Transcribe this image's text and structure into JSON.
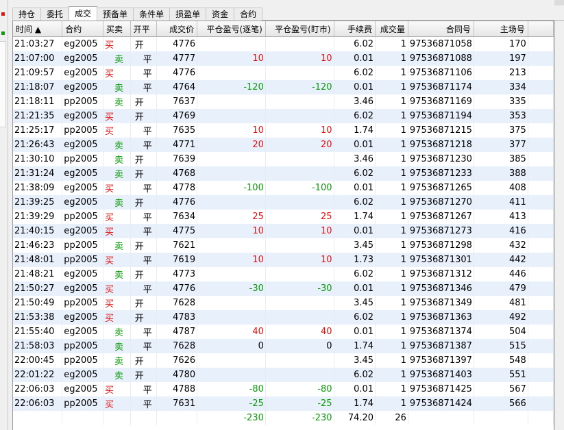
{
  "tabs": [
    "持仓",
    "委托",
    "成交",
    "预备单",
    "条件单",
    "损盈单",
    "资金",
    "合约"
  ],
  "active_tab": "成交",
  "columns": [
    "时间 ▲",
    "合约",
    "买卖",
    "开平",
    "成交价",
    "平仓盈亏(逐笔)",
    "平仓盈亏(盯市)",
    "手续费",
    "成交量",
    "合同号",
    "主场号"
  ],
  "rows": [
    {
      "time": "21:03:27",
      "contract": "eg2005",
      "side": "买",
      "oc": "开",
      "price": "4776",
      "pnl_trade": "",
      "pnl_mark": "",
      "fee": "6.02",
      "qty": "1",
      "order_no": "97536871058",
      "match_no": "170"
    },
    {
      "time": "21:07:00",
      "contract": "eg2005",
      "side": "卖",
      "oc": "平",
      "price": "4777",
      "pnl_trade": "10",
      "pnl_mark": "10",
      "fee": "0.01",
      "qty": "1",
      "order_no": "97536871088",
      "match_no": "197"
    },
    {
      "time": "21:09:57",
      "contract": "eg2005",
      "side": "买",
      "oc": "平",
      "price": "4776",
      "pnl_trade": "",
      "pnl_mark": "",
      "fee": "6.02",
      "qty": "1",
      "order_no": "97536871106",
      "match_no": "213"
    },
    {
      "time": "21:18:07",
      "contract": "eg2005",
      "side": "卖",
      "oc": "平",
      "price": "4764",
      "pnl_trade": "-120",
      "pnl_mark": "-120",
      "fee": "0.01",
      "qty": "1",
      "order_no": "97536871174",
      "match_no": "334"
    },
    {
      "time": "21:18:11",
      "contract": "pp2005",
      "side": "卖",
      "oc": "开",
      "price": "7637",
      "pnl_trade": "",
      "pnl_mark": "",
      "fee": "3.46",
      "qty": "1",
      "order_no": "97536871169",
      "match_no": "335"
    },
    {
      "time": "21:21:35",
      "contract": "eg2005",
      "side": "买",
      "oc": "开",
      "price": "4769",
      "pnl_trade": "",
      "pnl_mark": "",
      "fee": "6.02",
      "qty": "1",
      "order_no": "97536871194",
      "match_no": "353"
    },
    {
      "time": "21:25:17",
      "contract": "pp2005",
      "side": "买",
      "oc": "平",
      "price": "7635",
      "pnl_trade": "10",
      "pnl_mark": "10",
      "fee": "1.74",
      "qty": "1",
      "order_no": "97536871215",
      "match_no": "375"
    },
    {
      "time": "21:26:43",
      "contract": "eg2005",
      "side": "卖",
      "oc": "平",
      "price": "4771",
      "pnl_trade": "20",
      "pnl_mark": "20",
      "fee": "0.01",
      "qty": "1",
      "order_no": "97536871218",
      "match_no": "377"
    },
    {
      "time": "21:30:10",
      "contract": "pp2005",
      "side": "卖",
      "oc": "开",
      "price": "7639",
      "pnl_trade": "",
      "pnl_mark": "",
      "fee": "3.46",
      "qty": "1",
      "order_no": "97536871230",
      "match_no": "385"
    },
    {
      "time": "21:31:24",
      "contract": "eg2005",
      "side": "卖",
      "oc": "开",
      "price": "4768",
      "pnl_trade": "",
      "pnl_mark": "",
      "fee": "6.02",
      "qty": "1",
      "order_no": "97536871233",
      "match_no": "388"
    },
    {
      "time": "21:38:09",
      "contract": "eg2005",
      "side": "买",
      "oc": "平",
      "price": "4778",
      "pnl_trade": "-100",
      "pnl_mark": "-100",
      "fee": "0.01",
      "qty": "1",
      "order_no": "97536871265",
      "match_no": "408"
    },
    {
      "time": "21:39:25",
      "contract": "eg2005",
      "side": "卖",
      "oc": "开",
      "price": "4776",
      "pnl_trade": "",
      "pnl_mark": "",
      "fee": "6.02",
      "qty": "1",
      "order_no": "97536871270",
      "match_no": "411"
    },
    {
      "time": "21:39:29",
      "contract": "pp2005",
      "side": "买",
      "oc": "平",
      "price": "7634",
      "pnl_trade": "25",
      "pnl_mark": "25",
      "fee": "1.74",
      "qty": "1",
      "order_no": "97536871267",
      "match_no": "413"
    },
    {
      "time": "21:40:15",
      "contract": "eg2005",
      "side": "买",
      "oc": "平",
      "price": "4775",
      "pnl_trade": "10",
      "pnl_mark": "10",
      "fee": "0.01",
      "qty": "1",
      "order_no": "97536871273",
      "match_no": "416"
    },
    {
      "time": "21:46:23",
      "contract": "pp2005",
      "side": "卖",
      "oc": "开",
      "price": "7621",
      "pnl_trade": "",
      "pnl_mark": "",
      "fee": "3.45",
      "qty": "1",
      "order_no": "97536871298",
      "match_no": "432"
    },
    {
      "time": "21:48:01",
      "contract": "pp2005",
      "side": "买",
      "oc": "平",
      "price": "7619",
      "pnl_trade": "10",
      "pnl_mark": "10",
      "fee": "1.73",
      "qty": "1",
      "order_no": "97536871301",
      "match_no": "442"
    },
    {
      "time": "21:48:21",
      "contract": "eg2005",
      "side": "卖",
      "oc": "开",
      "price": "4773",
      "pnl_trade": "",
      "pnl_mark": "",
      "fee": "6.02",
      "qty": "1",
      "order_no": "97536871312",
      "match_no": "446"
    },
    {
      "time": "21:50:27",
      "contract": "eg2005",
      "side": "买",
      "oc": "平",
      "price": "4776",
      "pnl_trade": "-30",
      "pnl_mark": "-30",
      "fee": "0.01",
      "qty": "1",
      "order_no": "97536871346",
      "match_no": "479"
    },
    {
      "time": "21:50:49",
      "contract": "pp2005",
      "side": "买",
      "oc": "开",
      "price": "7628",
      "pnl_trade": "",
      "pnl_mark": "",
      "fee": "3.45",
      "qty": "1",
      "order_no": "97536871349",
      "match_no": "481"
    },
    {
      "time": "21:53:38",
      "contract": "eg2005",
      "side": "买",
      "oc": "开",
      "price": "4783",
      "pnl_trade": "",
      "pnl_mark": "",
      "fee": "6.02",
      "qty": "1",
      "order_no": "97536871363",
      "match_no": "492"
    },
    {
      "time": "21:55:40",
      "contract": "eg2005",
      "side": "卖",
      "oc": "平",
      "price": "4787",
      "pnl_trade": "40",
      "pnl_mark": "40",
      "fee": "0.01",
      "qty": "1",
      "order_no": "97536871374",
      "match_no": "504"
    },
    {
      "time": "21:58:03",
      "contract": "pp2005",
      "side": "卖",
      "oc": "平",
      "price": "7628",
      "pnl_trade": "0",
      "pnl_mark": "0",
      "fee": "1.74",
      "qty": "1",
      "order_no": "97536871387",
      "match_no": "515"
    },
    {
      "time": "22:00:45",
      "contract": "pp2005",
      "side": "卖",
      "oc": "开",
      "price": "7626",
      "pnl_trade": "",
      "pnl_mark": "",
      "fee": "3.45",
      "qty": "1",
      "order_no": "97536871397",
      "match_no": "548"
    },
    {
      "time": "22:01:22",
      "contract": "eg2005",
      "side": "卖",
      "oc": "开",
      "price": "4780",
      "pnl_trade": "",
      "pnl_mark": "",
      "fee": "6.02",
      "qty": "1",
      "order_no": "97536871403",
      "match_no": "551"
    },
    {
      "time": "22:06:03",
      "contract": "eg2005",
      "side": "买",
      "oc": "平",
      "price": "4788",
      "pnl_trade": "-80",
      "pnl_mark": "-80",
      "fee": "0.01",
      "qty": "1",
      "order_no": "97536871425",
      "match_no": "567"
    },
    {
      "time": "22:06:03",
      "contract": "pp2005",
      "side": "买",
      "oc": "平",
      "price": "7631",
      "pnl_trade": "-25",
      "pnl_mark": "-25",
      "fee": "1.74",
      "qty": "1",
      "order_no": "97536871424",
      "match_no": "566"
    }
  ],
  "totals": {
    "pnl_trade": "-230",
    "pnl_mark": "-230",
    "fee": "74.20",
    "qty": "26"
  },
  "colors": {
    "buy": "#e01010",
    "sell": "#0a9a0a",
    "row_alt": "#e8f0fb"
  }
}
